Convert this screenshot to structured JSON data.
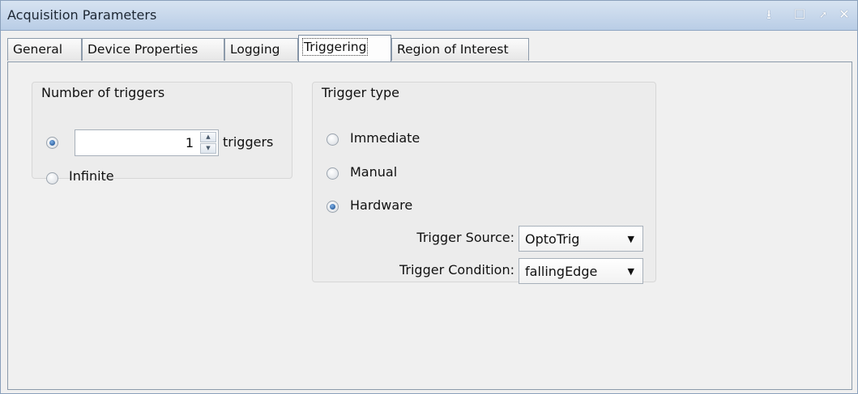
{
  "window": {
    "title": "Acquisition Parameters"
  },
  "titlebar_icons": [
    "dock-icon",
    "maximize-icon",
    "undock-icon",
    "close-icon"
  ],
  "titlebar_glyphs": {
    "dock": "⭳",
    "maximize": "☐",
    "undock": "➚",
    "close": "✕"
  },
  "tabs": [
    {
      "label": "General"
    },
    {
      "label": "Device Properties"
    },
    {
      "label": "Logging"
    },
    {
      "label": "Triggering",
      "selected": true
    },
    {
      "label": "Region of Interest"
    }
  ],
  "number_of_triggers": {
    "title": "Number of triggers",
    "count_value": "1",
    "count_unit": "triggers",
    "infinite_label": "Infinite",
    "selected": "count"
  },
  "trigger_type": {
    "title": "Trigger type",
    "options": [
      {
        "label": "Immediate",
        "selected": false
      },
      {
        "label": "Manual",
        "selected": false
      },
      {
        "label": "Hardware",
        "selected": true
      }
    ],
    "source_label": "Trigger Source:",
    "source_value": "OptoTrig",
    "condition_label": "Trigger Condition:",
    "condition_value": "fallingEdge"
  }
}
